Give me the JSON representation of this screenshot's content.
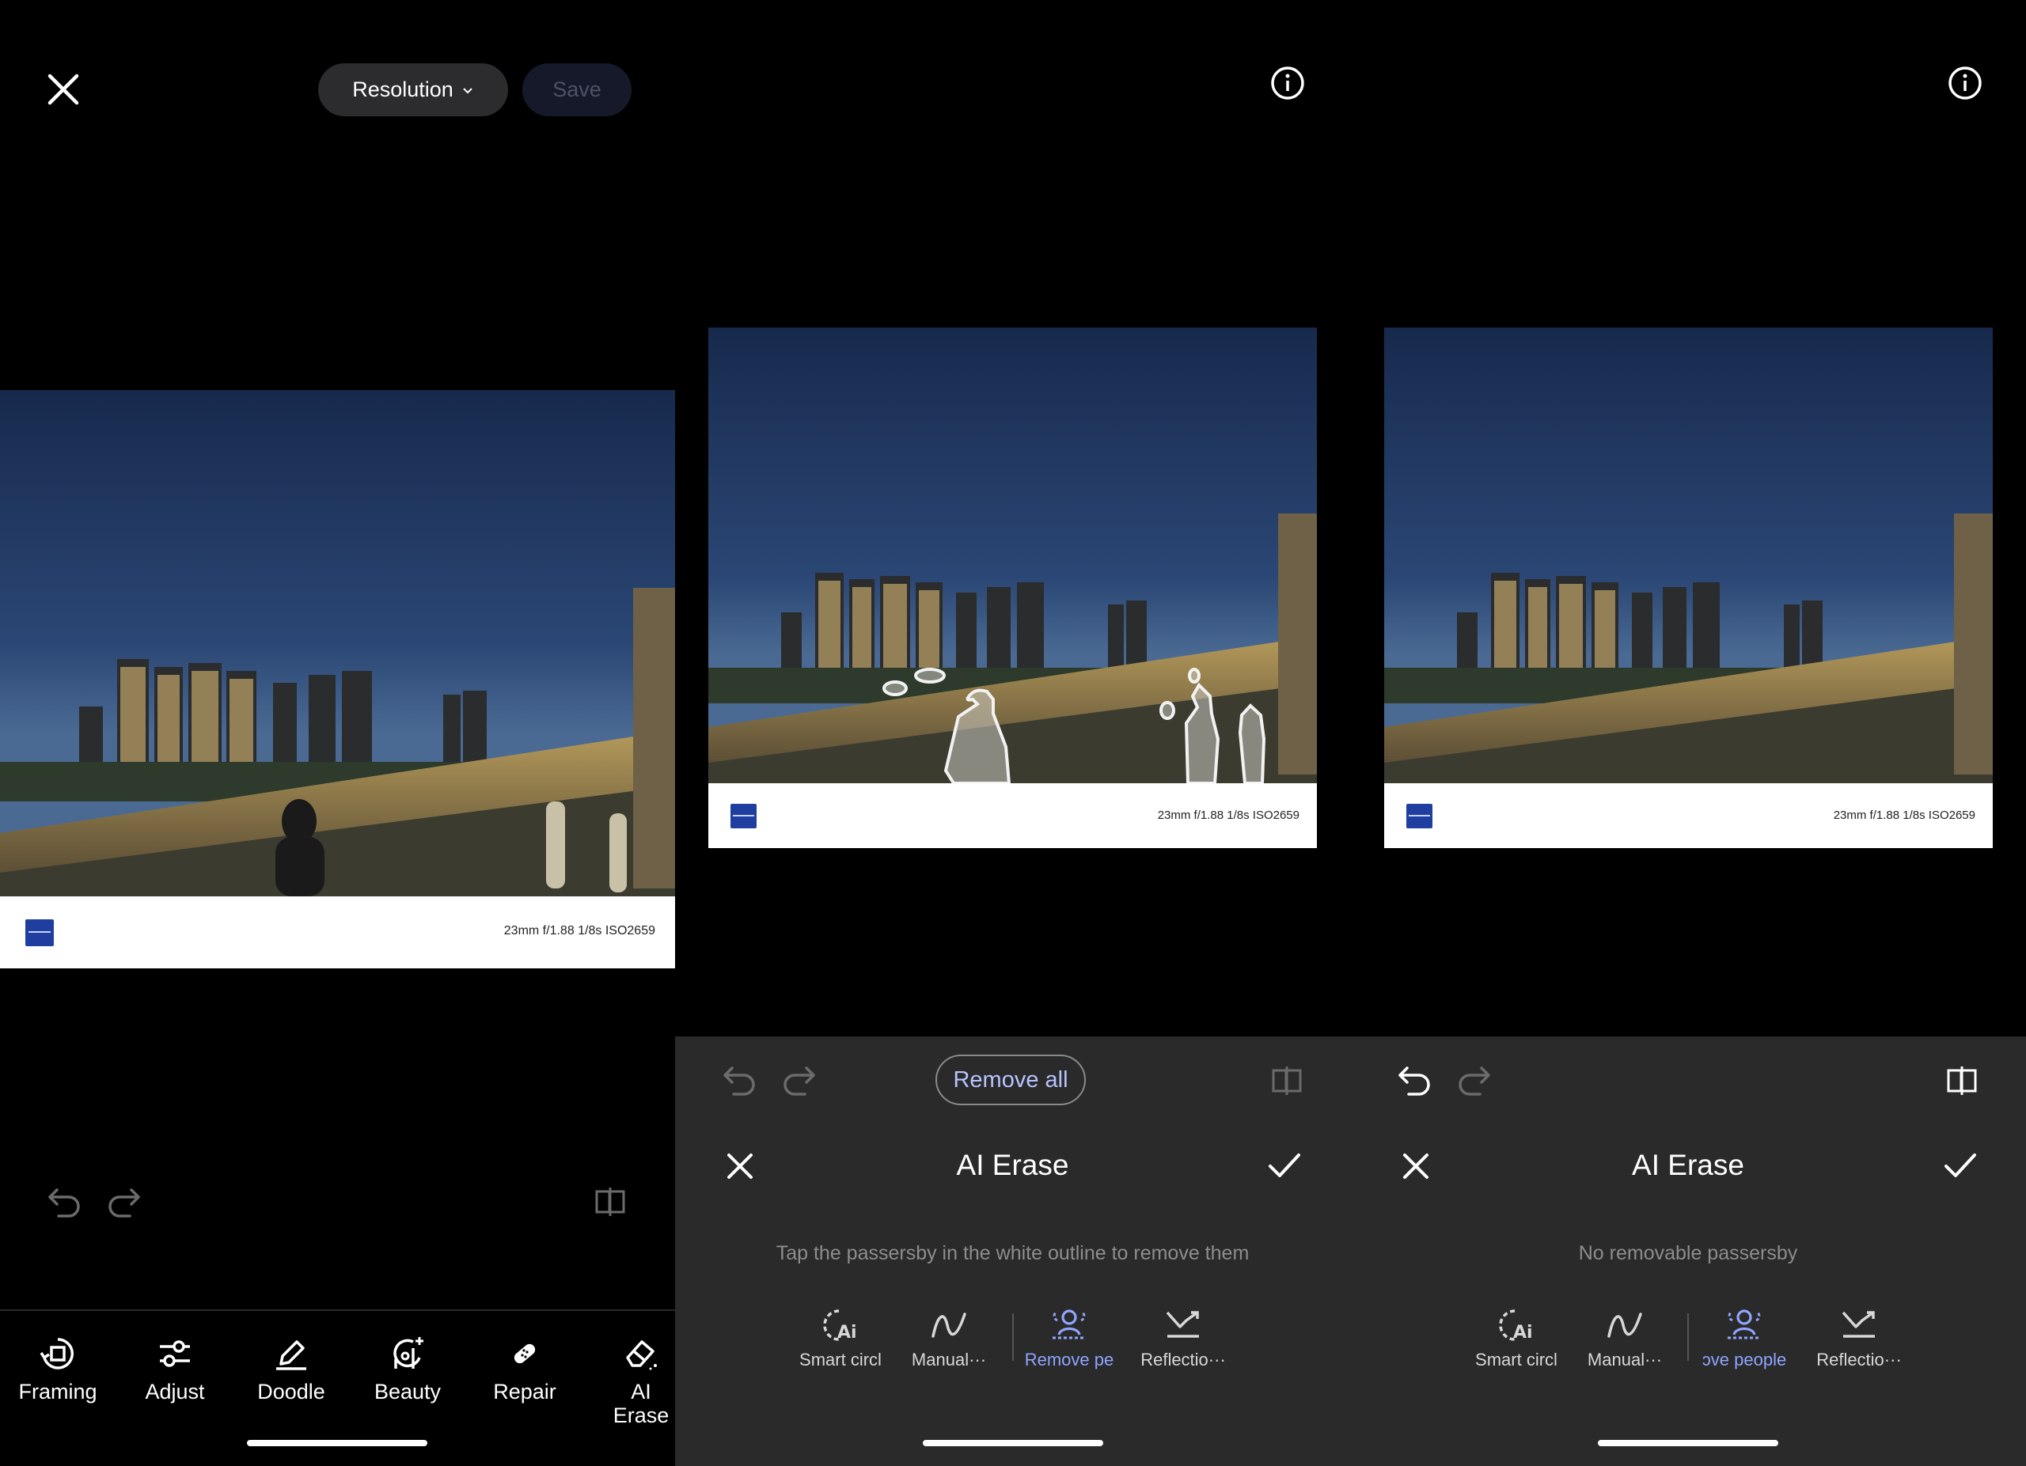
{
  "panel1": {
    "resolution_label": "Resolution",
    "save_label": "Save",
    "exif": "23mm  f/1.88  1/8s  ISO2659",
    "tools": [
      {
        "label": "Framing",
        "icon": "framing-icon"
      },
      {
        "label": "Adjust",
        "icon": "adjust-icon"
      },
      {
        "label": "Doodle",
        "icon": "doodle-icon"
      },
      {
        "label": "Beauty",
        "icon": "beauty-icon"
      },
      {
        "label": "Repair",
        "icon": "repair-icon"
      },
      {
        "label": "AI\nErase",
        "icon": "ai-erase-icon"
      }
    ]
  },
  "panel2": {
    "exif": "23mm  f/1.88  1/8s  ISO2659",
    "remove_all_label": "Remove all",
    "title": "AI Erase",
    "hint": "Tap the passersby in the white outline to remove them",
    "tools": [
      {
        "label": "Smart circl",
        "icon": "smart-circle-icon",
        "active": false
      },
      {
        "label": "Manual···",
        "icon": "manual-icon",
        "active": false
      },
      {
        "label": "Remove pe",
        "icon": "remove-people-icon",
        "active": true
      },
      {
        "label": "Reflectio···",
        "icon": "reflection-icon",
        "active": false
      }
    ]
  },
  "panel3": {
    "exif": "23mm  f/1.88  1/8s  ISO2659",
    "title": "AI Erase",
    "hint": "No removable passersby",
    "tools": [
      {
        "label": "Smart circl",
        "icon": "smart-circle-icon",
        "active": false
      },
      {
        "label": "Manual···",
        "icon": "manual-icon",
        "active": false
      },
      {
        "label": "ɔve people",
        "icon": "remove-people-icon",
        "active": true
      },
      {
        "label": "Reflectio···",
        "icon": "reflection-icon",
        "active": false
      }
    ]
  },
  "colors": {
    "accent": "#8fa5ff",
    "sheet_bg": "#2a2a2a",
    "zeiss_blue": "#1f3ea0"
  }
}
